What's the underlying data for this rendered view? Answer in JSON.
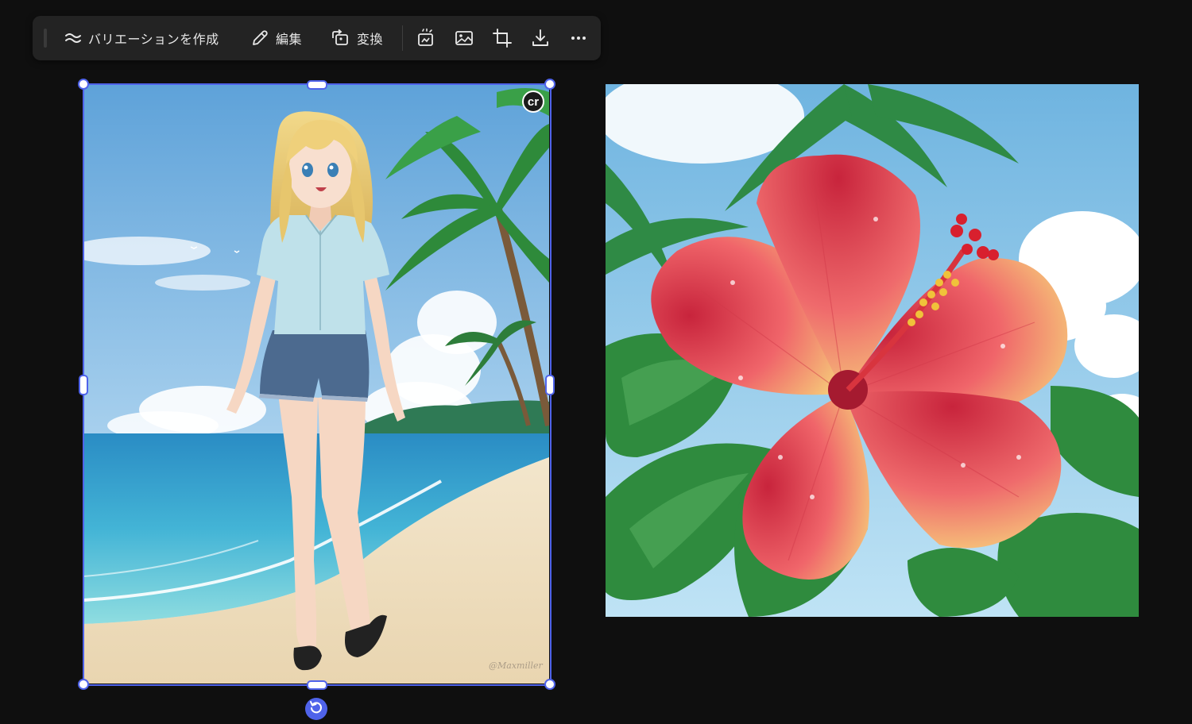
{
  "toolbar": {
    "variations_label": "バリエーションを作成",
    "edit_label": "編集",
    "convert_label": "変換",
    "icons": [
      "approx-icon",
      "pencil-icon",
      "convert-icon",
      "generate-icon",
      "image-icon",
      "crop-icon",
      "download-icon",
      "more-icon"
    ]
  },
  "canvas": {
    "selected_image": "anime-girl-beach",
    "other_image": "hibiscus-flower",
    "badge_text": "cr",
    "signature_text": "@Maxmiller"
  },
  "colors": {
    "background": "#0f0f0f",
    "toolbar": "#232323",
    "selection": "#4f63ea"
  }
}
